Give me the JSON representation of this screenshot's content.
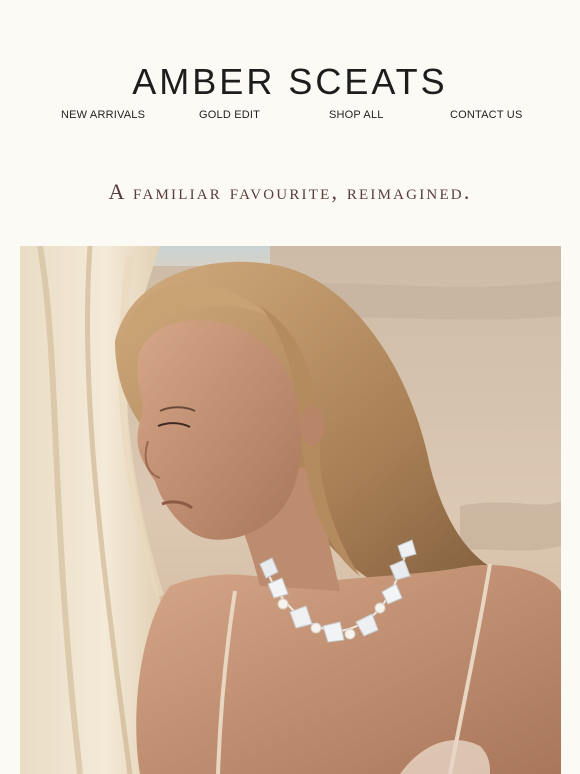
{
  "brand": {
    "name": "AMBER SCEATS"
  },
  "nav": {
    "items": [
      {
        "label": "NEW ARRIVALS"
      },
      {
        "label": "GOLD EDIT"
      },
      {
        "label": "SHOP ALL"
      },
      {
        "label": "CONTACT US"
      }
    ]
  },
  "tagline": {
    "text": "A familiar favourite, reimagined."
  },
  "hero": {
    "subject": "model-wearing-crystal-pearl-necklace-on-beach"
  },
  "colors": {
    "background": "#fcfaf5",
    "brand_text": "#1d1d1d",
    "tagline_text": "#5a3d3a",
    "sand": "#d9c4ad",
    "skin": "#c49478",
    "hair": "#b58e62"
  }
}
